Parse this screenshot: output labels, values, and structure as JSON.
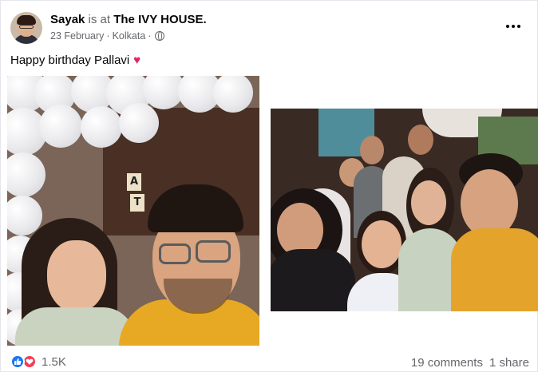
{
  "post": {
    "author": "Sayak",
    "checkin_text": "is at",
    "place": "The IVY HOUSE.",
    "date": "23 February",
    "separator": "·",
    "location": "Kolkata",
    "privacy_icon": "globe-icon",
    "more_icon": "more-options-icon",
    "caption": "Happy birthday Pallavi",
    "caption_emoji": "♥",
    "reactions": {
      "icons": [
        "like-icon",
        "love-icon"
      ],
      "count": "1.5K"
    },
    "comments": "19 comments",
    "shares": "1 share"
  },
  "colors": {
    "accent_like": "#1877f2",
    "accent_love": "#f33e58",
    "secondary_text": "#65676b",
    "heart": "#e0245e"
  }
}
